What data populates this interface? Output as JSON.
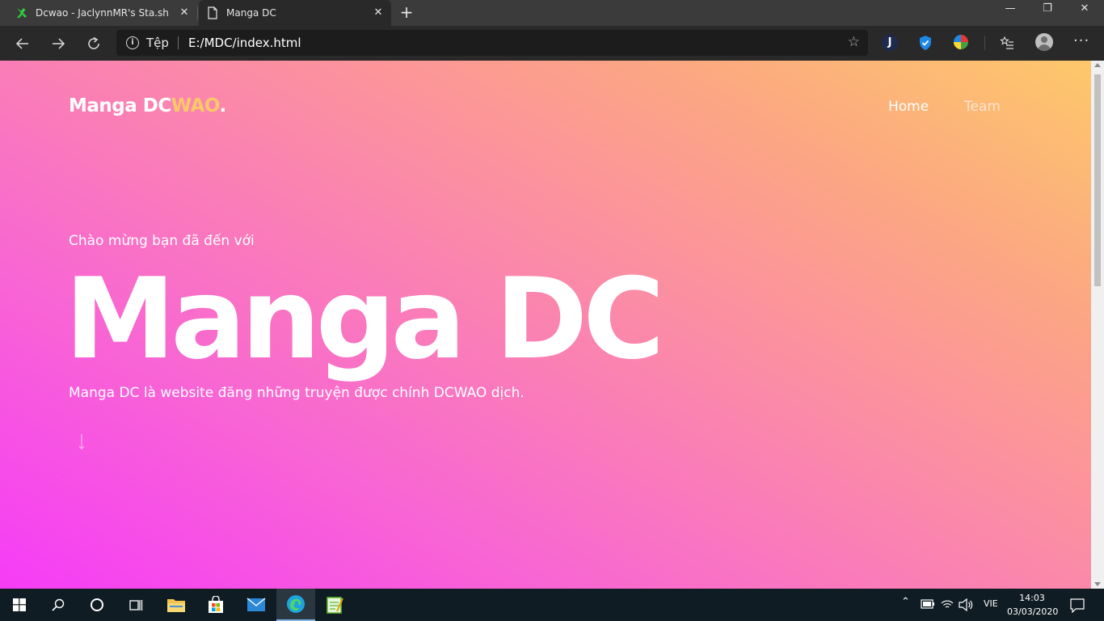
{
  "browser": {
    "tabs": [
      {
        "title": "Dcwao - JaclynnMR's Sta.sh",
        "favicon": "stash-icon",
        "active": false
      },
      {
        "title": "Manga DC",
        "favicon": "page-icon",
        "active": true
      }
    ],
    "new_tab_label": "+",
    "address": {
      "protocol_label": "Tệp",
      "url": "E:/MDC/index.html"
    },
    "window_controls": {
      "minimize": "—",
      "restore": "❐",
      "close": "✕"
    }
  },
  "page": {
    "logo_main": "Manga DC",
    "logo_accent": "WAO",
    "logo_dot": ".",
    "nav": [
      {
        "label": "Home"
      },
      {
        "label": "Team"
      }
    ],
    "welcome": "Chào mừng bạn đã đến với",
    "hero_title": "Manga DC",
    "hero_description": "Manga DC là website đăng những truyện được chính DCWAO dịch.",
    "colors": {
      "gradient_start": "#f63cf7",
      "gradient_end": "#fdc86a",
      "logo_accent": "#fdc86a"
    }
  },
  "taskbar": {
    "language": "VIE",
    "time": "14:03",
    "date": "03/03/2020"
  }
}
